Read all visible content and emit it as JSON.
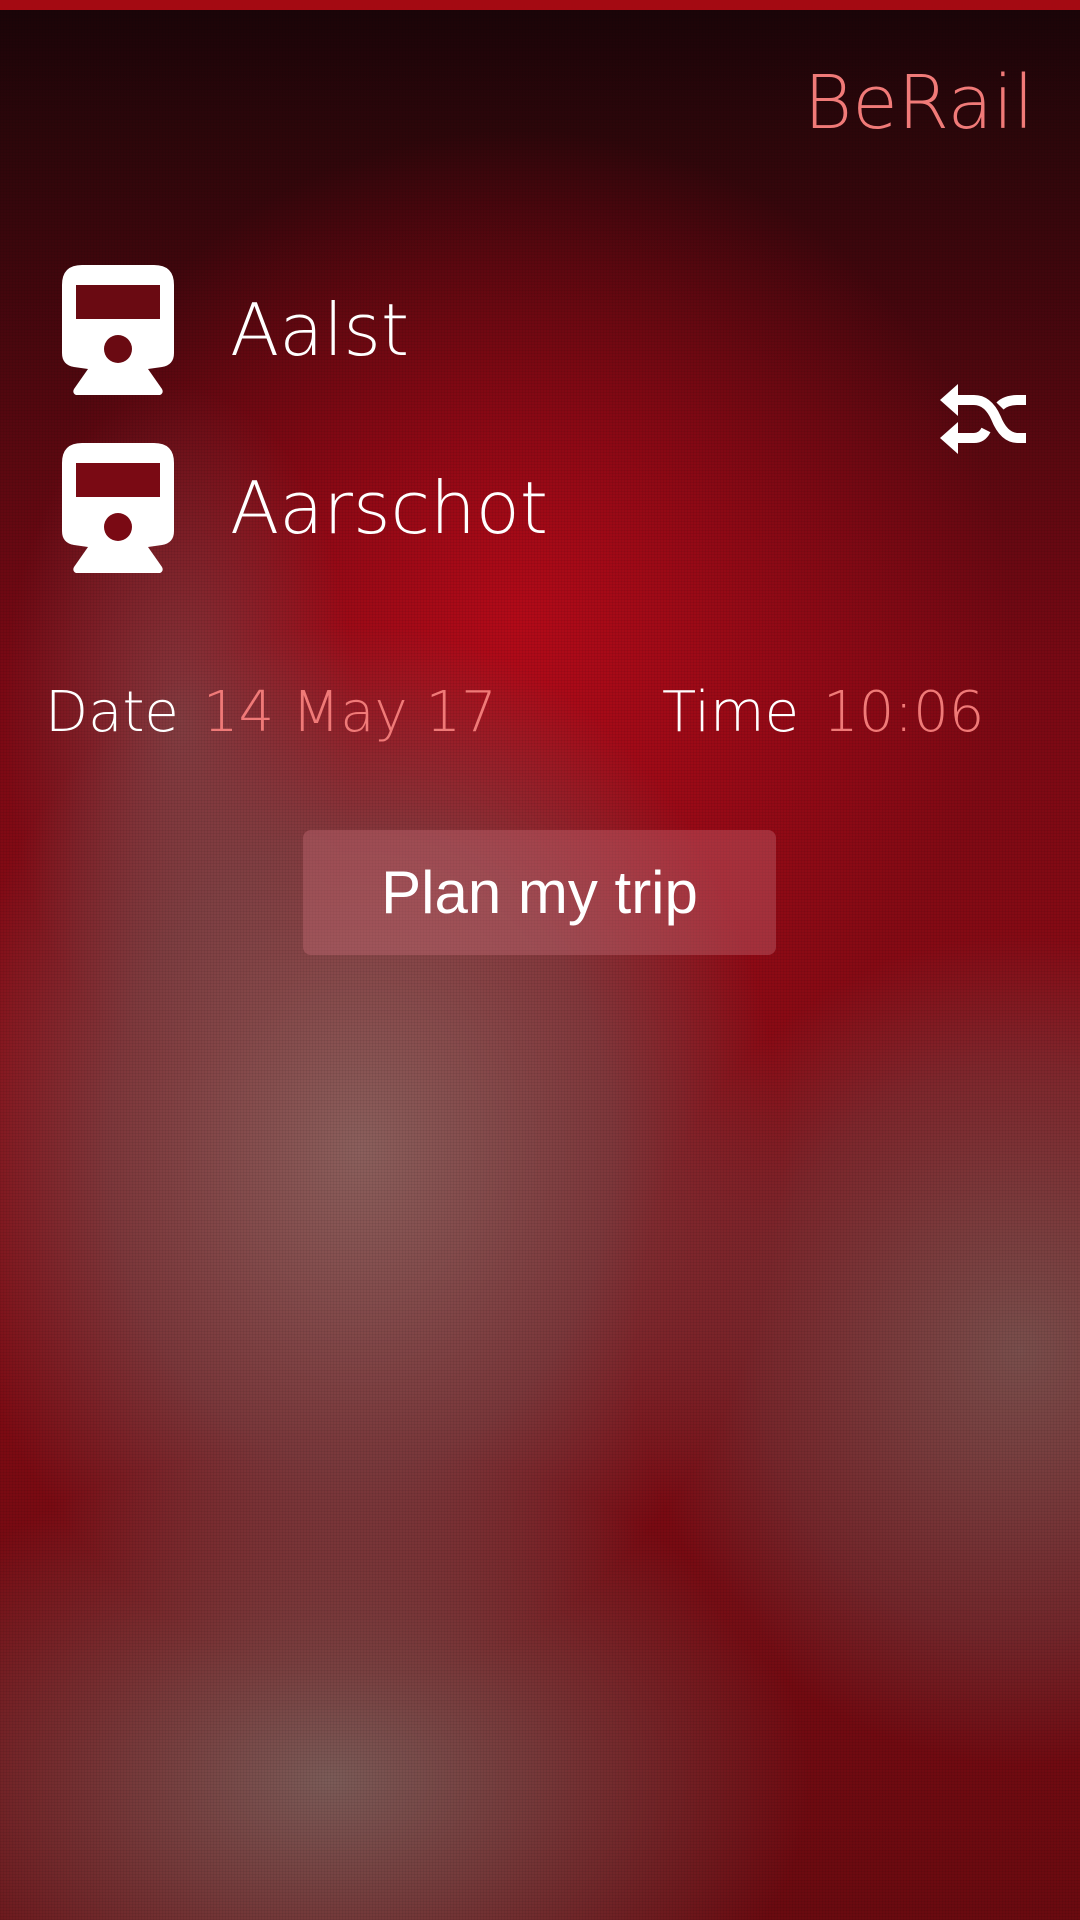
{
  "app": {
    "title": "BeRail",
    "accent_color": "#f07a78",
    "topbar_color": "#a40a12"
  },
  "trip": {
    "from": {
      "station": "Aalst",
      "icon": "train-icon"
    },
    "to": {
      "station": "Aarschot",
      "icon": "train-icon"
    },
    "swap_icon": "shuffle-swap-icon"
  },
  "datetime": {
    "date_label": "Date",
    "date_value": "14 May 17",
    "time_label": "Time",
    "time_value": "10:06"
  },
  "actions": {
    "plan_label": "Plan my trip"
  }
}
